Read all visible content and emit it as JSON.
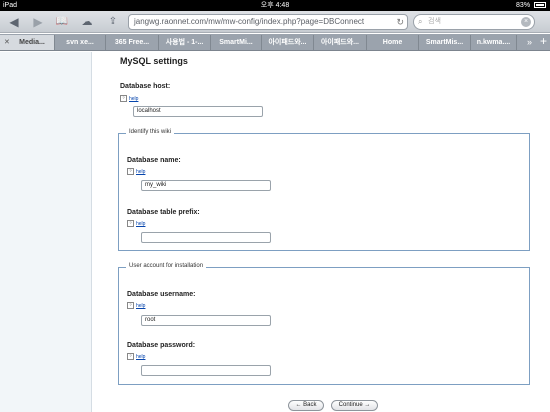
{
  "status_bar": {
    "device": "iPad",
    "time": "오후 4:48",
    "battery": "83%"
  },
  "toolbar": {
    "url": "jangwg.raonnet.com/mw/mw-config/index.php?page=DBConnect",
    "search_placeholder": "검색"
  },
  "tabs": [
    {
      "label": "Media..."
    },
    {
      "label": "svn xe..."
    },
    {
      "label": "365 Free..."
    },
    {
      "label": "사용법 - 1-..."
    },
    {
      "label": "SmartMi..."
    },
    {
      "label": "아이패드와..."
    },
    {
      "label": "아이패드와..."
    },
    {
      "label": "Home"
    },
    {
      "label": "SmartMis..."
    },
    {
      "label": "n.kwma...."
    }
  ],
  "page": {
    "title": "MySQL settings",
    "help_label": "help",
    "db_host": {
      "label": "Database host:",
      "value": "localhost"
    },
    "identify_fieldset": {
      "legend": "Identify this wiki",
      "db_name": {
        "label": "Database name:",
        "value": "my_wiki"
      },
      "db_prefix": {
        "label": "Database table prefix:",
        "value": ""
      }
    },
    "user_fieldset": {
      "legend": "User account for installation",
      "db_user": {
        "label": "Database username:",
        "value": "root"
      },
      "db_pass": {
        "label": "Database password:",
        "value": ""
      }
    },
    "back_button": "← Back",
    "continue_button": "Continue →"
  }
}
